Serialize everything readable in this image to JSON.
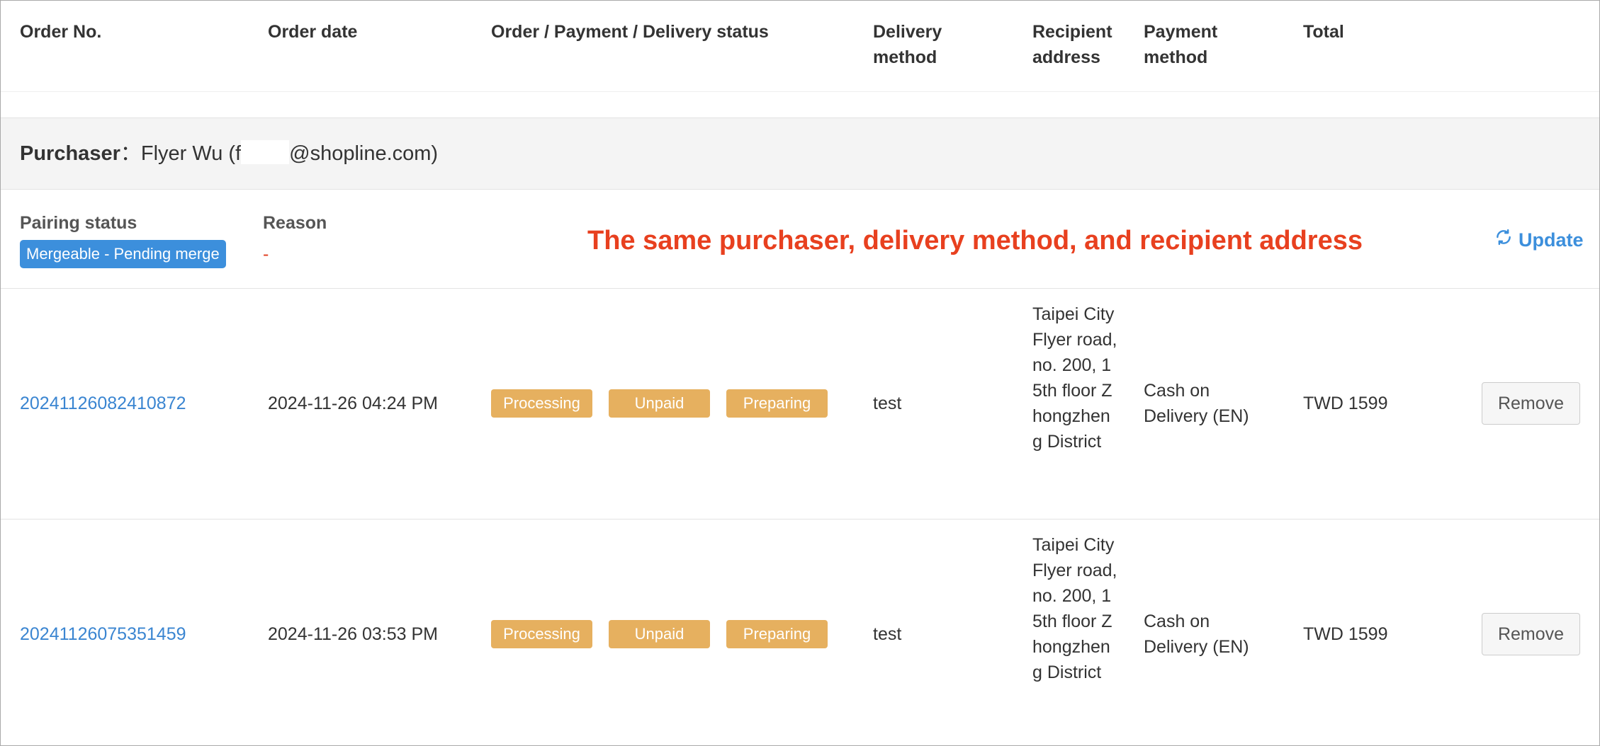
{
  "header": {
    "columns": [
      "Order No.",
      "Order date",
      "Order / Payment / Delivery status",
      "Delivery\nmethod",
      "Recipient\naddress",
      "Payment\nmethod",
      "Total"
    ]
  },
  "purchaser": {
    "label": "Purchaser",
    "separator": "：",
    "name_prefix": "Flyer Wu (f",
    "email_suffix": "@shopline.com)"
  },
  "pairing": {
    "status_label": "Pairing status",
    "status_value": "Mergeable - Pending merge",
    "reason_label": "Reason",
    "reason_value": "-",
    "update_label": "Update",
    "update_icon": "refresh-icon"
  },
  "annotation": "The same purchaser, delivery method, and recipient address",
  "orders": [
    {
      "order_no": "20241126082410872",
      "order_date": "2024-11-26 04:24 PM",
      "order_status": "Processing",
      "payment_status": "Unpaid",
      "delivery_status": "Preparing",
      "delivery_method": "test",
      "recipient_address": "Taipei City Flyer road, no. 200, 15th floor Zhongzheng District",
      "payment_method": "Cash on Delivery (EN)",
      "total": "TWD 1599",
      "remove_label": "Remove"
    },
    {
      "order_no": "20241126075351459",
      "order_date": "2024-11-26 03:53 PM",
      "order_status": "Processing",
      "payment_status": "Unpaid",
      "delivery_status": "Preparing",
      "delivery_method": "test",
      "recipient_address": "Taipei City Flyer road, no. 200, 15th floor Zhongzheng District",
      "payment_method": "Cash on Delivery (EN)",
      "total": "TWD 1599",
      "remove_label": "Remove"
    }
  ],
  "colors": {
    "link": "#3a85d1",
    "badge_blue": "#3c8fdc",
    "status_badge": "#e6b05f",
    "annotation": "#e8401f"
  }
}
